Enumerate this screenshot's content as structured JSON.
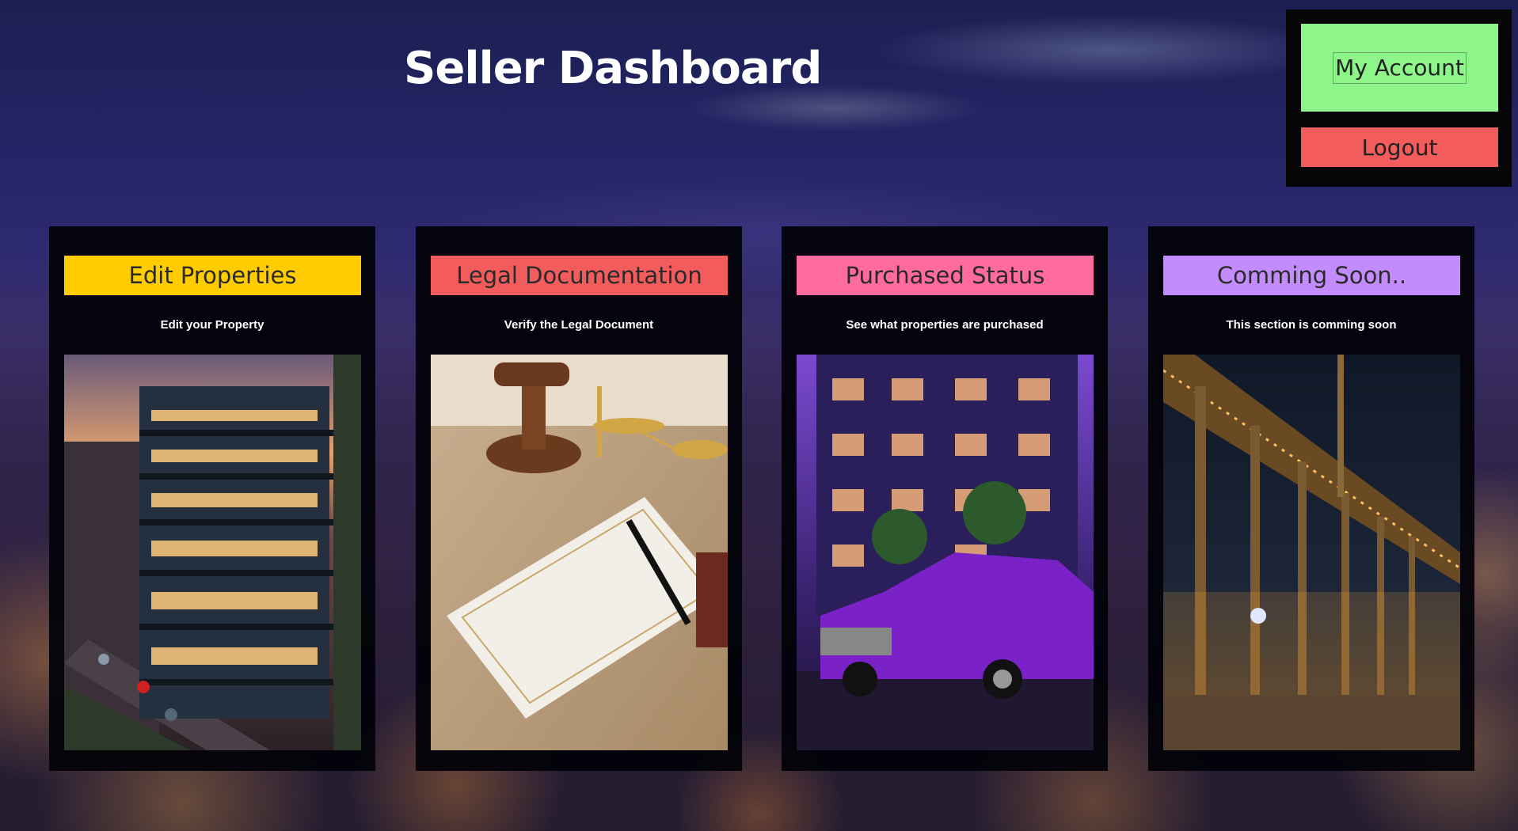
{
  "header": {
    "title": "Seller Dashboard"
  },
  "account": {
    "my_account_label": "My Account",
    "logout_label": "Logout"
  },
  "cards": [
    {
      "title": "Edit Properties",
      "description": "Edit your Property",
      "color": "#ffcc00",
      "image": "modern-apartment-building-photo"
    },
    {
      "title": "Legal Documentation",
      "description": "Verify the Legal Document",
      "color": "#f25c5c",
      "image": "gavel-and-legal-document-photo"
    },
    {
      "title": "Purchased Status",
      "description": "See what properties are purchased",
      "color": "#ff6b9d",
      "image": "purple-car-and-apartment-photo"
    },
    {
      "title": "Comming Soon..",
      "description": "This section is comming soon",
      "color": "#c28cff",
      "image": "construction-site-at-night-photo"
    }
  ],
  "colors": {
    "my_account_button": "#8ef58a",
    "logout_button": "#f25c5c",
    "panel_background": "#060608"
  }
}
